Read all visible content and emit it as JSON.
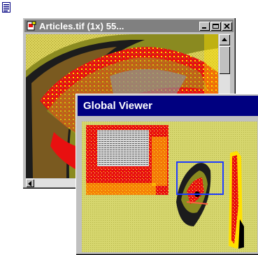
{
  "desktop": {
    "doc_icon": "document-lines-icon"
  },
  "back_window": {
    "title": "Articles.tif (1x) 55...",
    "title_icon": "image-document-icon",
    "buttons": [
      "minimize-icon",
      "maximize-icon",
      "close-icon"
    ]
  },
  "front_window": {
    "title": "Global Viewer"
  },
  "colors": {
    "active_title": "#000080",
    "inactive_title": "#808080",
    "face": "#c0c0c0",
    "image_yellow": "#d9d05a",
    "image_red": "#e81010",
    "view_box": "#1e3cff"
  }
}
